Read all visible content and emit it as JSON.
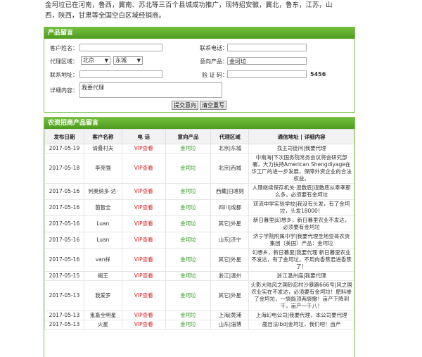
{
  "intro": {
    "line1": "金坷垃已在河南，鲁西，冀南、苏北等三百个县城成功推广，现特招安徽，冀北，鲁东，江苏，山",
    "line2": "西，陕西，甘肃等全国空白区域经销商。"
  },
  "form": {
    "title": "产品留言",
    "customer_label": "客户姓名：",
    "customer_value": "",
    "phone_label": "联系电话：",
    "phone_value": "",
    "region_label": "代理区域：",
    "province": "北京",
    "district": "东城",
    "product_label": "意向产品：",
    "product_value": "金坷垃",
    "address_label": "联系地址：",
    "address_value": "",
    "captcha_label": "验 证 码：",
    "captcha_value": "",
    "captcha_code": "5456",
    "content_label": "详细内容：",
    "content_value": "我要代理",
    "submit_label": "提交意向",
    "reset_label": "清空重写"
  },
  "list": {
    "title": "农资招商产品留言",
    "columns": [
      "发布日期",
      "客户名称",
      "电 话",
      "意向产品",
      "代理区域",
      "通信地址 | 详细内容"
    ],
    "rows": [
      {
        "date": "2017-05-19",
        "name": "请叠村夫",
        "phone": "VIP查看",
        "product": "金坷垃",
        "region": "北京|东城",
        "addr": "找王司徒问|我要代理"
      },
      {
        "date": "2017-05-18",
        "name": "李亮强",
        "phone": "VIP查看",
        "product": "金坷垃",
        "region": "北京|西城",
        "addr": "中南海|下次国务院常务会议将会研究部署，大力扶持American Shengdiyage在华工厂的进一步发展，保障外资企业的合法权益。"
      },
      {
        "date": "2017-05-16",
        "name": "列奥纳多·达·",
        "phone": "VIP查看",
        "product": "金坷垃",
        "region": "西藏|日喀则",
        "addr": "人理继续保存机关·逗敷底|逗敷底从奉孝那么多，必须要有金坷垃"
      },
      {
        "date": "2017-05-16",
        "name": "菌智全",
        "phone": "VIP查看",
        "product": "金坷垃",
        "region": "四川|成都",
        "addr": "双流中学实验学校|我没有头发，有了金坷垃，头发18000！"
      },
      {
        "date": "2017-05-16",
        "name": "Luan",
        "phone": "VIP查看",
        "product": "金坷垃",
        "region": "其它|外星",
        "addr": "新日暮里|幻想乡，新日暮里农业不发达，必须要有金坷垃"
      },
      {
        "date": "2017-05-16",
        "name": "Luan",
        "phone": "VIP查看",
        "product": "金坷垃",
        "region": "山东|济宁",
        "addr": "济宁学院附属中学|我要代理圣地亚哥农资集团（美国）产品：金坷垃"
      },
      {
        "date": "2017-05-16",
        "name": "van样",
        "phone": "VIP查看",
        "product": "金坷垃",
        "region": "其它|外星",
        "addr": "幻想乡，新日暮里|我要代理 新日暮里农业不发达，有了金坷垃，不用肉香蕉君进香蕉了！"
      },
      {
        "date": "2017-05-15",
        "name": "阚王",
        "phone": "VIP查看",
        "product": "金坷垃",
        "region": "浙江|温州",
        "addr": "浙江温州庙|我要代理"
      },
      {
        "date": "2017-05-13",
        "name": "我爱罗",
        "phone": "VIP查看",
        "product": "金坷垃",
        "region": "其它|外星",
        "addr": "火影大陆风之国砂忍村沙暴路666号|风之国农业实在不发达，必须要有金坷垃！肥料掺了金坷垃，一袋能顶两袋撒！亩产下降到千，亩产一千八！"
      },
      {
        "date": "2017-05-13",
        "name": "鬼畜全明星",
        "phone": "VIP查看",
        "product": "金坷垃",
        "region": "上海|黄浦",
        "addr": "上海幻电公司|我要代理，本公司要代理"
      },
      {
        "date": "2017-05-13",
        "name": "火星",
        "phone": "VIP查看",
        "product": "金坷垃",
        "region": "山东|淄博",
        "addr": "鹿目法lbd|金坷垃，我们吧！亩产"
      }
    ]
  }
}
